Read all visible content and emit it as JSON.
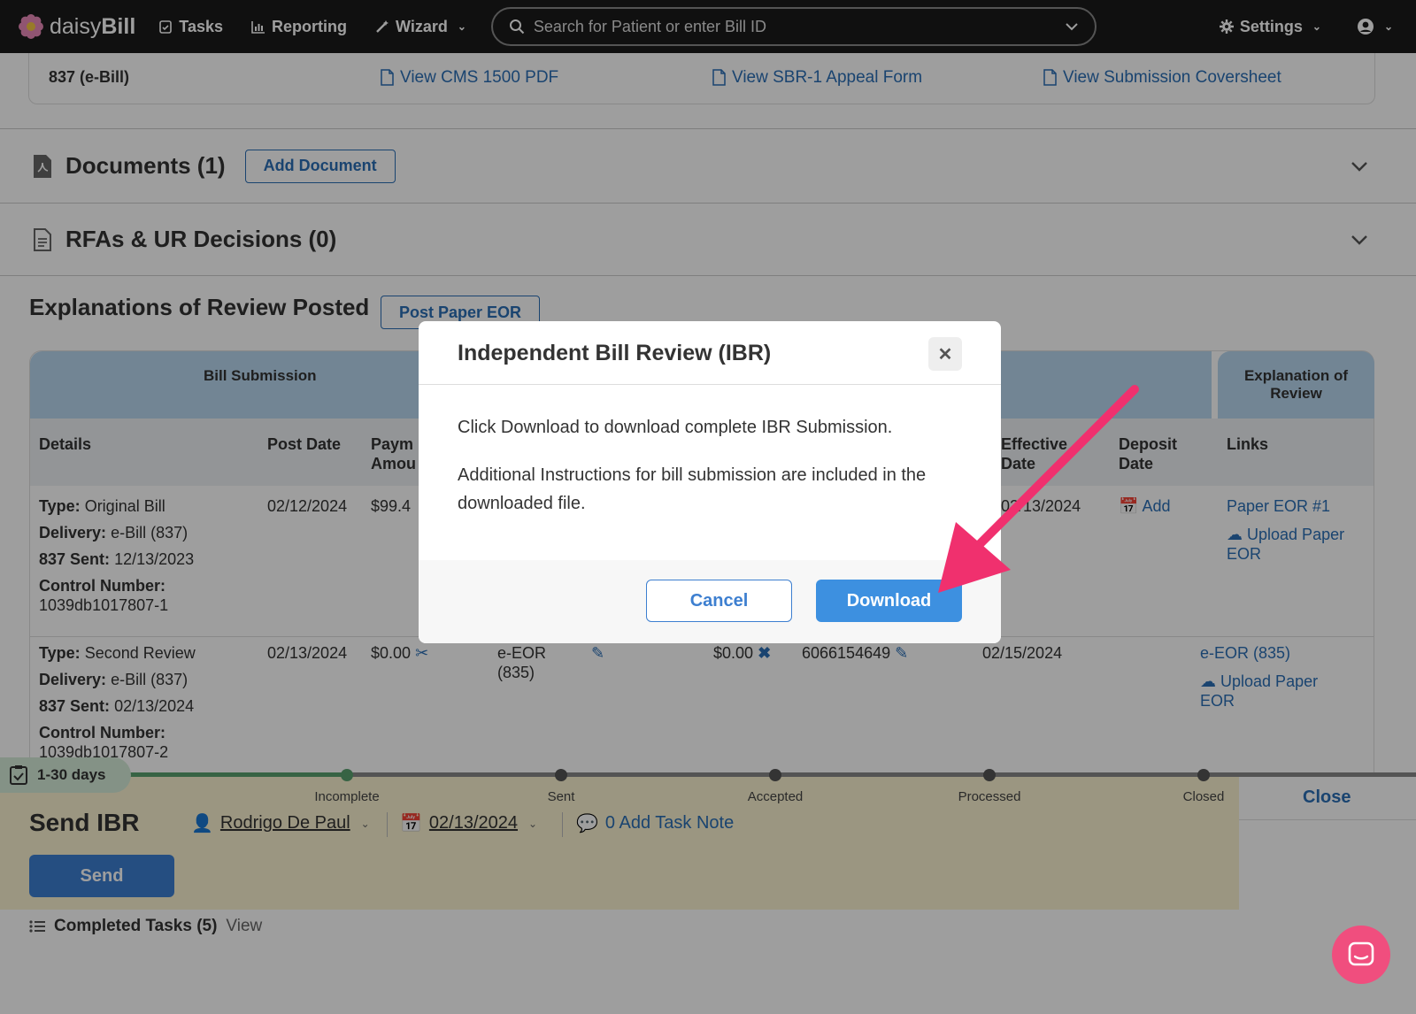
{
  "nav": {
    "logo_prefix": "daisy",
    "logo_suffix": "Bill",
    "tasks": "Tasks",
    "reporting": "Reporting",
    "wizard": "Wizard",
    "search_placeholder": "Search for Patient or enter Bill ID",
    "settings": "Settings"
  },
  "billing_forms": {
    "type": "837 (e-Bill)",
    "links": [
      "View CMS 1500 PDF",
      "View SBR-1 Appeal Form",
      "View Submission Coversheet"
    ]
  },
  "documents": {
    "title": "Documents (1)",
    "button": "Add Document"
  },
  "rfas": {
    "title": "RFAs & UR Decisions (0)"
  },
  "eor": {
    "title": "Explanations of Review Posted",
    "button": "Post Paper EOR",
    "groups": {
      "bill_submission": "Bill Submission",
      "explanation": "Explanation of Review"
    },
    "columns": {
      "details": "Details",
      "post_date": "Post Date",
      "payment_amount_1": "Paym",
      "payment_amount_2": "Amou",
      "effective_date_1": "Effective",
      "effective_date_2": "Date",
      "deposit_date_1": "Deposit",
      "deposit_date_2": "Date",
      "links": "Links"
    },
    "rows": [
      {
        "type_label": "Type:",
        "type": "Original Bill",
        "delivery_label": "Delivery:",
        "delivery": "e-Bill (837)",
        "sent_label": "837 Sent:",
        "sent": "12/13/2023",
        "control_label": "Control Number:",
        "control": "1039db1017807-1",
        "post_date": "02/12/2024",
        "payment": "$99.4",
        "effective_date": "02/13/2024",
        "deposit": "Add",
        "link1": "Paper EOR #1",
        "link2": "Upload Paper",
        "link2b": "EOR"
      },
      {
        "type_label": "Type:",
        "type": "Second Review",
        "delivery_label": "Delivery:",
        "delivery": "e-Bill (837)",
        "sent_label": "837 Sent:",
        "sent": "02/13/2024",
        "control_label": "Control Number:",
        "control": "1039db1017807-2",
        "post_date": "02/13/2024",
        "payment": "$0.00",
        "method_1": "e-EOR",
        "method_2": "(835)",
        "amount": "$0.00",
        "check_number": "6066154649",
        "effective_date": "02/15/2024",
        "link1": "e-EOR (835)",
        "link2": "Upload Paper",
        "link2b": "EOR"
      }
    ]
  },
  "task": {
    "days": "1-30 days",
    "steps": [
      "Incomplete",
      "Sent",
      "Accepted",
      "Processed",
      "Closed"
    ],
    "close": "Close",
    "title": "Send IBR",
    "assignee": "Rodrigo De Paul",
    "date": "02/13/2024",
    "note": "0 Add Task Note",
    "send": "Send",
    "completed": "Completed Tasks (5)",
    "view": "View"
  },
  "modal": {
    "title": "Independent Bill Review (IBR)",
    "line1": "Click Download to download complete IBR Submission.",
    "line2": "Additional Instructions for bill submission are included in the downloaded file.",
    "cancel": "Cancel",
    "download": "Download"
  },
  "colors": {
    "accent": "#3d90e0",
    "link": "#2a6eb5",
    "arrow": "#f0306e",
    "header": "#b9d7ef"
  }
}
